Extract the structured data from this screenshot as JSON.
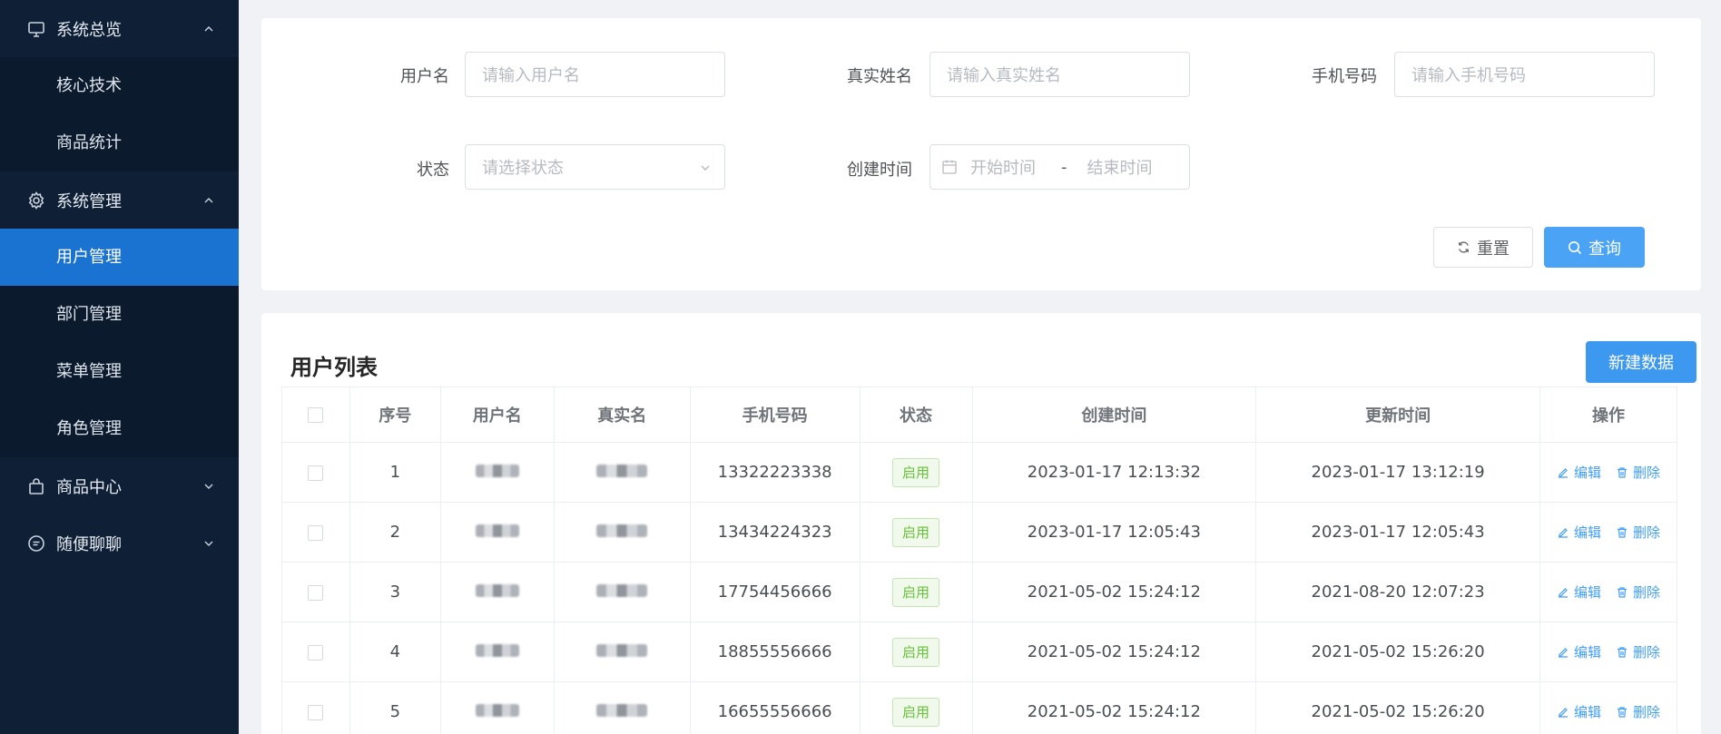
{
  "sidebar": {
    "groups": [
      {
        "label": "系统总览",
        "icon": "monitor-icon",
        "expanded": true,
        "items": [
          "核心技术",
          "商品统计"
        ]
      },
      {
        "label": "系统管理",
        "icon": "gear-icon",
        "expanded": true,
        "items": [
          "用户管理",
          "部门管理",
          "菜单管理",
          "角色管理"
        ]
      },
      {
        "label": "商品中心",
        "icon": "shopping-bag-icon",
        "expanded": false,
        "items": []
      },
      {
        "label": "随便聊聊",
        "icon": "chat-icon",
        "expanded": false,
        "items": []
      }
    ],
    "active_item": "用户管理"
  },
  "filters": {
    "username_label": "用户名",
    "username_placeholder": "请输入用户名",
    "realname_label": "真实姓名",
    "realname_placeholder": "请输入真实姓名",
    "phone_label": "手机号码",
    "phone_placeholder": "请输入手机号码",
    "status_label": "状态",
    "status_placeholder": "请选择状态",
    "created_label": "创建时间",
    "start_placeholder": "开始时间",
    "date_sep": "-",
    "end_placeholder": "结束时间",
    "reset_label": "重置",
    "query_label": "查询"
  },
  "table": {
    "title": "用户列表",
    "new_label": "新建数据",
    "columns": [
      "序号",
      "用户名",
      "真实名",
      "手机号码",
      "状态",
      "创建时间",
      "更新时间",
      "操作"
    ],
    "edit_label": "编辑",
    "delete_label": "删除",
    "rows": [
      {
        "index": "1",
        "phone": "13322223338",
        "status": "启用",
        "created": "2023-01-17 12:13:32",
        "updated": "2023-01-17 13:12:19"
      },
      {
        "index": "2",
        "phone": "13434224323",
        "status": "启用",
        "created": "2023-01-17 12:05:43",
        "updated": "2023-01-17 12:05:43"
      },
      {
        "index": "3",
        "phone": "17754456666",
        "status": "启用",
        "created": "2021-05-02 15:24:12",
        "updated": "2021-08-20 12:07:23"
      },
      {
        "index": "4",
        "phone": "18855556666",
        "status": "启用",
        "created": "2021-05-02 15:24:12",
        "updated": "2021-05-02 15:26:20"
      },
      {
        "index": "5",
        "phone": "16655556666",
        "status": "启用",
        "created": "2021-05-02 15:24:12",
        "updated": "2021-05-02 15:26:20"
      }
    ]
  },
  "colors": {
    "sidebar_bg": "#0f2036",
    "active_bg": "#1a73d1",
    "primary": "#409eff",
    "success": "#67c23a"
  }
}
